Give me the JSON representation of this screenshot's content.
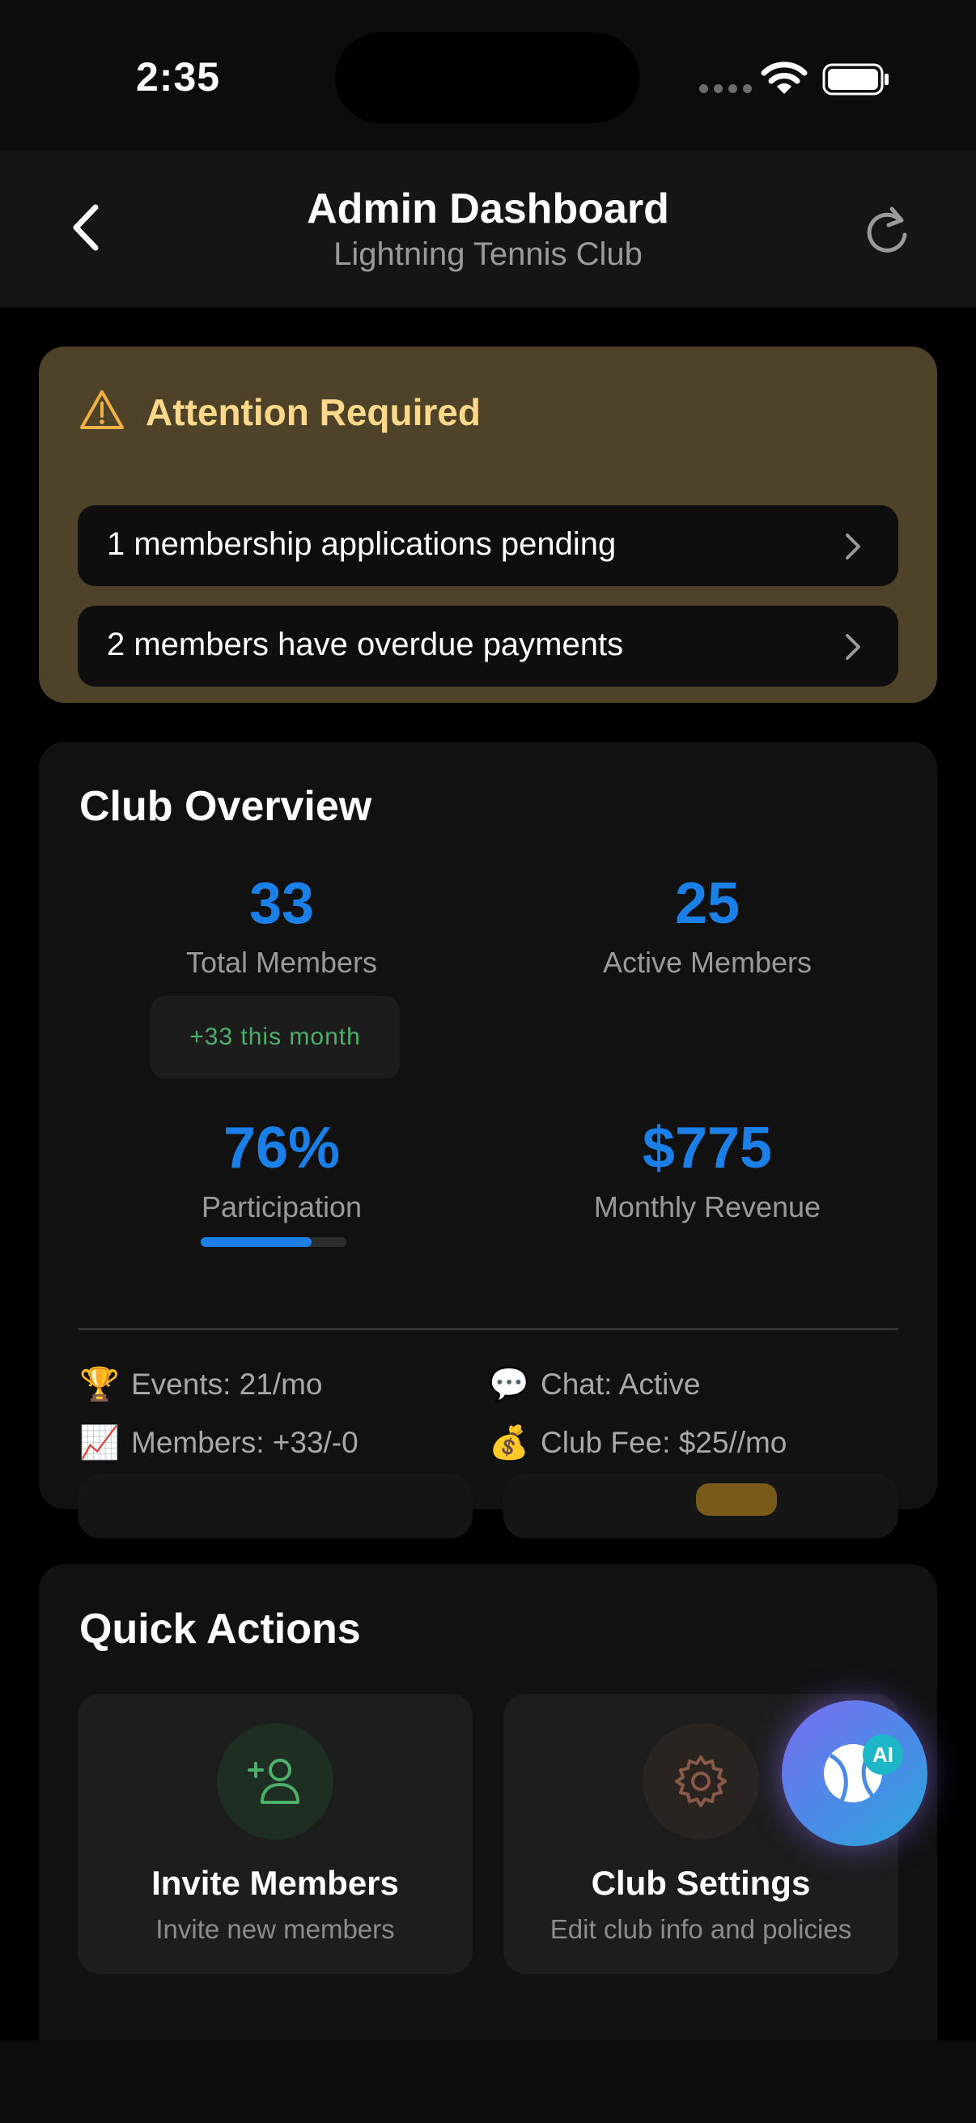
{
  "status_bar": {
    "time": "2:35"
  },
  "header": {
    "title": "Admin Dashboard",
    "subtitle": "Lightning Tennis Club"
  },
  "attention": {
    "title": "Attention Required",
    "alerts": [
      {
        "label": "1 membership applications pending"
      },
      {
        "label": "2 members have overdue payments"
      }
    ]
  },
  "overview": {
    "title": "Club Overview",
    "total_members": {
      "value": "33",
      "label": "Total Members",
      "badge": "+33 this month"
    },
    "active_members": {
      "value": "25",
      "label": "Active Members"
    },
    "participation": {
      "value": "76%",
      "label": "Participation",
      "progress_fraction": 0.76
    },
    "monthly_revenue": {
      "value": "$775",
      "label": "Monthly Revenue"
    },
    "info": [
      {
        "emoji": "🏆",
        "label": "Events: 21/mo"
      },
      {
        "emoji": "💬",
        "label": "Chat: Active"
      },
      {
        "emoji": "📈",
        "label": "Members: +33/-0"
      },
      {
        "emoji": "💰",
        "label": "Club Fee: $25//mo"
      }
    ]
  },
  "quick_actions": {
    "title": "Quick Actions",
    "items": [
      {
        "title": "Invite Members",
        "description": "Invite new members",
        "icon": "add-user-icon",
        "color": "#4caf6a"
      },
      {
        "title": "Club Settings",
        "description": "Edit club info and policies",
        "icon": "gear-icon",
        "color": "#8a5a48"
      }
    ]
  },
  "ai_button": {
    "badge": "AI"
  },
  "colors": {
    "accent": "#1a7fe6",
    "warning": "#fcd98a",
    "success": "#4caf6a"
  }
}
